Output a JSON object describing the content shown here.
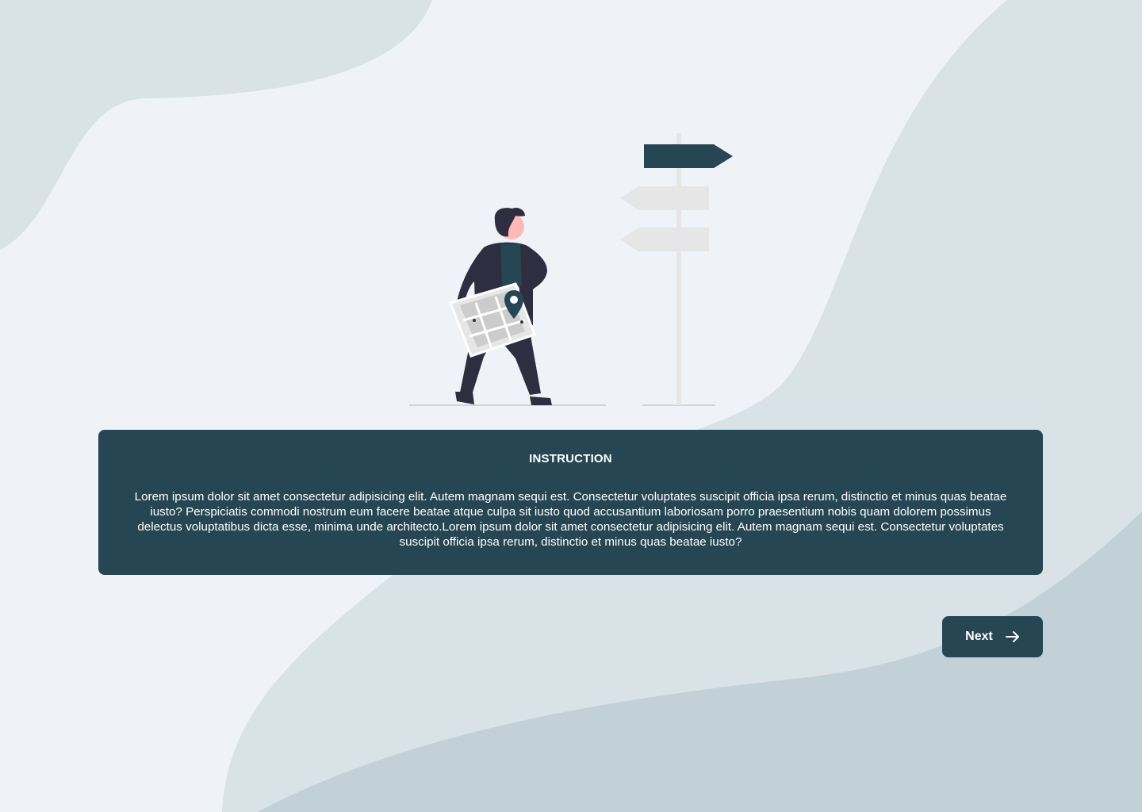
{
  "instruction": {
    "title": "INSTRUCTION",
    "body": "Lorem ipsum dolor sit amet consectetur adipisicing elit. Autem magnam sequi est. Consectetur voluptates suscipit officia ipsa rerum, distinctio et minus quas beatae iusto? Perspiciatis commodi nostrum eum facere beatae atque culpa sit iusto quod accusantium laboriosam porro praesentium nobis quam dolorem possimus delectus voluptatibus dicta esse, minima unde architecto.Lorem ipsum dolor sit amet consectetur adipisicing elit. Autem magnam sequi est. Consectetur voluptates suscipit officia ipsa rerum, distinctio et minus quas beatae iusto?"
  },
  "navigation": {
    "next_label": "Next",
    "next_icon": "arrow-right-icon"
  },
  "colors": {
    "background": "#eff3f8",
    "blob_light": "#d8e2e7",
    "blob_dark": "#c2d1d8",
    "card": "#264653",
    "card_text": "#ffffff"
  },
  "illustration": {
    "subject": "person-with-map-at-signpost"
  }
}
